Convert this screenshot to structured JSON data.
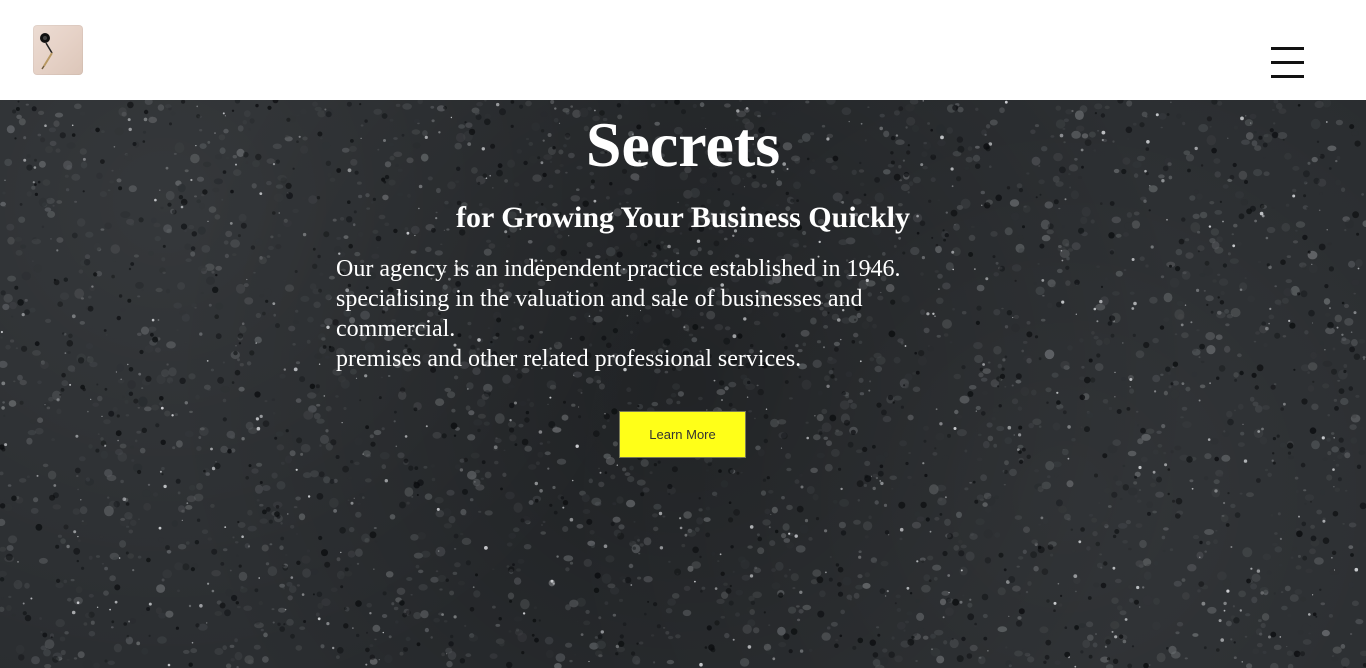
{
  "header": {
    "logo_icon": "quill-logo-icon",
    "menu_icon": "hamburger-menu-icon"
  },
  "hero": {
    "title": "Secrets",
    "subtitle": "for Growing Your Business Quickly",
    "paragraph_lines": [
      "Our agency is an independent practice established in 1946.",
      "specialising in the valuation and sale of businesses and",
      "commercial.",
      "premises and other related professional services."
    ],
    "cta_label": "Learn More",
    "background": "dark-gravel-texture"
  },
  "colors": {
    "header_bg": "#ffffff",
    "hero_bg": "#2a2d30",
    "text": "#ffffff",
    "cta_bg": "#ffff18",
    "cta_text": "#333333"
  }
}
